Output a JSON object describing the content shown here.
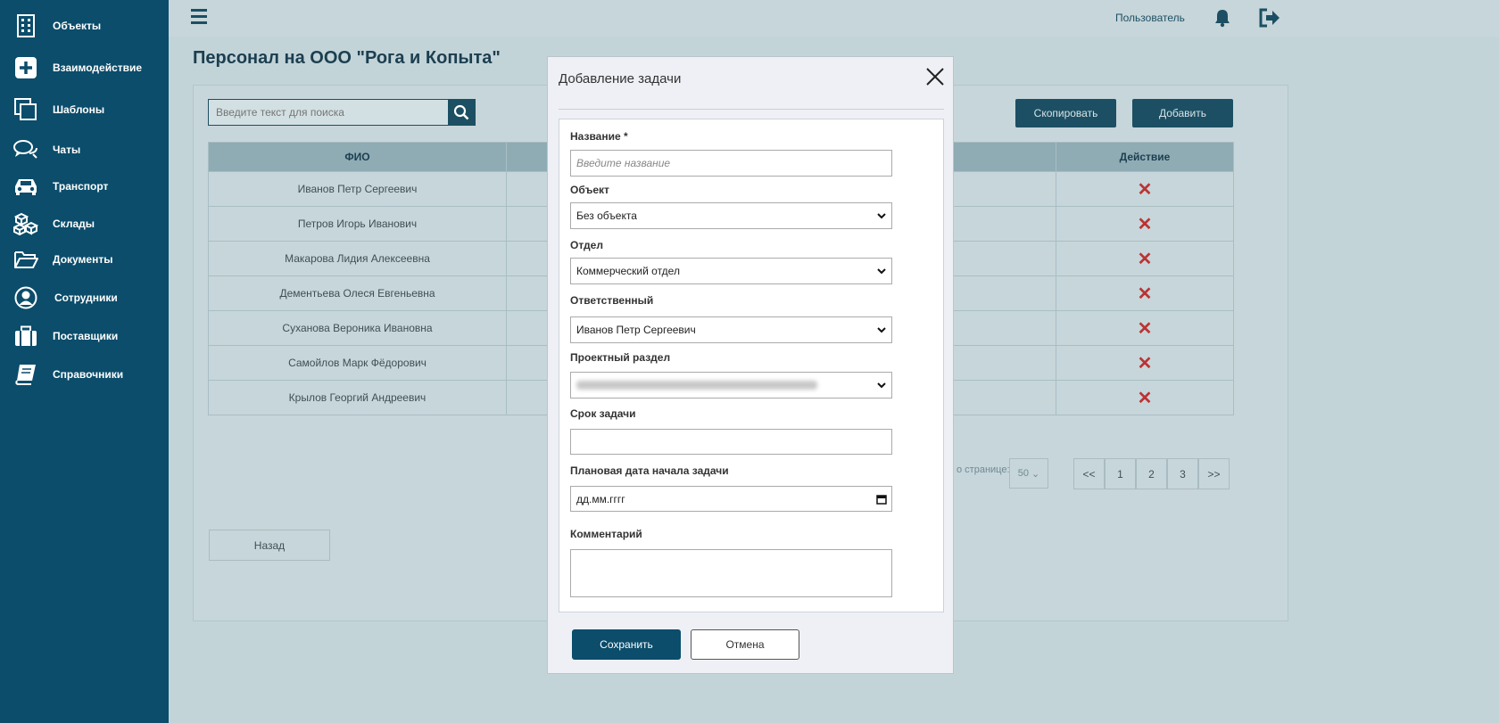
{
  "sidebar": {
    "items": [
      {
        "label": "Объекты",
        "icon": "building-icon"
      },
      {
        "label": "Взаимодействие",
        "icon": "plus-square-icon"
      },
      {
        "label": "Шаблоны",
        "icon": "copy-icon"
      },
      {
        "label": "Чаты",
        "icon": "chat-icon"
      },
      {
        "label": "Транспорт",
        "icon": "car-icon"
      },
      {
        "label": "Склады",
        "icon": "boxes-icon"
      },
      {
        "label": "Документы",
        "icon": "folder-icon"
      },
      {
        "label": "Сотрудники",
        "icon": "user-circle-icon"
      },
      {
        "label": "Поставщики",
        "icon": "briefcase-icon"
      },
      {
        "label": "Справочники",
        "icon": "book-icon"
      }
    ]
  },
  "topbar": {
    "user_label": "Пользователь"
  },
  "page": {
    "title": "Персонал на ООО \"Рога и Копыта\"",
    "search_placeholder": "Введите текст для поиска",
    "copy_label": "Скопировать",
    "add_label": "Добавить",
    "table": {
      "headers": [
        "ФИО",
        "Действие"
      ],
      "rows": [
        "Иванов Петр Сергеевич",
        "Петров Игорь Иванович",
        "Макарова Лидия Алексеевна",
        "Дементьева Олеся Евгеньевна",
        "Суханова Вероника Ивановна",
        "Самойлов Марк Фёдорович",
        "Крылов Георгий Андреевич"
      ]
    },
    "per_page_label": "о странице:",
    "per_page_value": "50",
    "pager": [
      "<<",
      "1",
      "2",
      "3",
      ">>"
    ],
    "back_label": "Назад"
  },
  "modal": {
    "title": "Добавление задачи",
    "fields": {
      "name_label": "Название *",
      "name_placeholder": "Введите название",
      "object_label": "Объект",
      "object_value": "Без объекта",
      "department_label": "Отдел",
      "department_value": "Коммерческий отдел",
      "responsible_label": "Ответственный",
      "responsible_value": "Иванов Петр Сергеевич",
      "project_label": "Проектный раздел",
      "deadline_label": "Срок задачи",
      "start_label": "Плановая дата начала задачи",
      "start_value": "дд.мм.гггг",
      "comment_label": "Комментарий"
    },
    "save_label": "Сохранить",
    "cancel_label": "Отмена"
  },
  "colors": {
    "sidebar_bg": "#0b4d6b",
    "accent": "#1c4f63",
    "delete": "#b33333"
  }
}
